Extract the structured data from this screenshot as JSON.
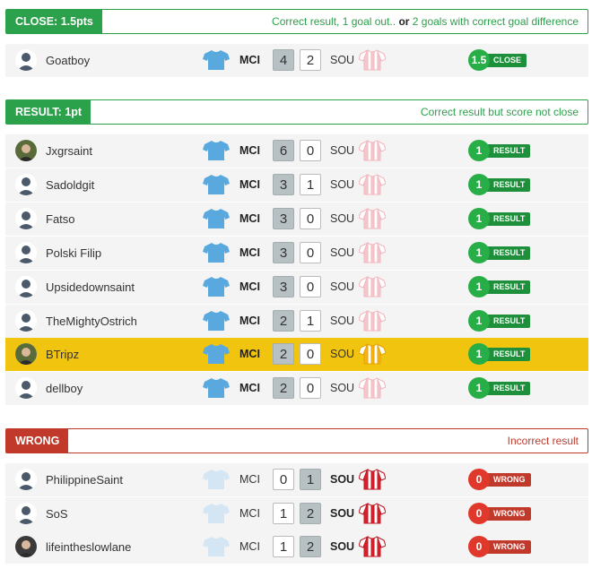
{
  "sections": {
    "close": {
      "tag": "CLOSE: 1.5pts",
      "desc_a": "Correct result, 1 goal out.. ",
      "desc_or": "or",
      "desc_b": " 2 goals with correct goal difference"
    },
    "result": {
      "tag": "RESULT: 1pt",
      "desc": "Correct result but score not close"
    },
    "wrong": {
      "tag": "WRONG",
      "desc": "Incorrect result"
    }
  },
  "match": {
    "home": "MCI",
    "away": "SOU"
  },
  "colors": {
    "green": "#2aa14a",
    "red": "#c0392b",
    "highlight": "#f1c40f",
    "mci_kit": "#5aa9de",
    "sou_kit": "#d9202a"
  },
  "rows": [
    {
      "user": "Goatboy",
      "avatar": "default-avatar-icon",
      "home_score": "4",
      "away_score": "2",
      "points": "1.5",
      "label": "CLOSE"
    },
    {
      "user": "Jxgrsaint",
      "avatar": "photo-avatar",
      "home_score": "6",
      "away_score": "0",
      "points": "1",
      "label": "RESULT"
    },
    {
      "user": "Sadoldgit",
      "avatar": "default-avatar-icon",
      "home_score": "3",
      "away_score": "1",
      "points": "1",
      "label": "RESULT"
    },
    {
      "user": "Fatso",
      "avatar": "default-avatar-icon",
      "home_score": "3",
      "away_score": "0",
      "points": "1",
      "label": "RESULT"
    },
    {
      "user": "Polski Filip",
      "avatar": "default-avatar-icon",
      "home_score": "3",
      "away_score": "0",
      "points": "1",
      "label": "RESULT"
    },
    {
      "user": "Upsidedownsaint",
      "avatar": "default-avatar-icon",
      "home_score": "3",
      "away_score": "0",
      "points": "1",
      "label": "RESULT"
    },
    {
      "user": "TheMightyOstrich",
      "avatar": "default-avatar-icon",
      "home_score": "2",
      "away_score": "1",
      "points": "1",
      "label": "RESULT"
    },
    {
      "user": "BTripz",
      "avatar": "photo-avatar",
      "home_score": "2",
      "away_score": "0",
      "points": "1",
      "label": "RESULT"
    },
    {
      "user": "dellboy",
      "avatar": "default-avatar-icon",
      "home_score": "2",
      "away_score": "0",
      "points": "1",
      "label": "RESULT"
    },
    {
      "user": "PhilippineSaint",
      "avatar": "default-avatar-icon",
      "home_score": "0",
      "away_score": "1",
      "points": "0",
      "label": "WRONG"
    },
    {
      "user": "SoS",
      "avatar": "default-avatar-icon",
      "home_score": "1",
      "away_score": "2",
      "points": "0",
      "label": "WRONG"
    },
    {
      "user": "lifeintheslowlane",
      "avatar": "photo-avatar",
      "home_score": "1",
      "away_score": "2",
      "points": "0",
      "label": "WRONG"
    }
  ]
}
